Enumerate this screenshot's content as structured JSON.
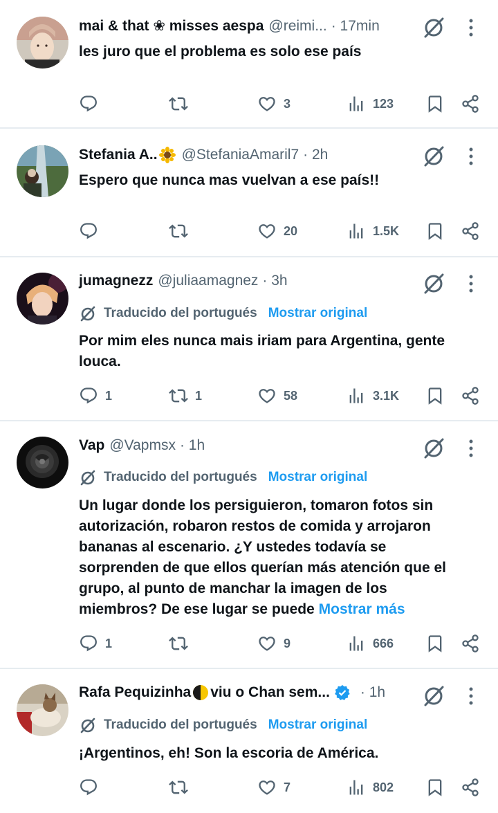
{
  "tweets": [
    {
      "name": "mai & that ❀ misses aespa",
      "handle": "@reimi...",
      "time": "· 17min",
      "text": "les juro que el problema es solo ese país",
      "reply_count": "",
      "retweet_count": "",
      "like_count": "3",
      "view_count": "123"
    },
    {
      "name": "Stefania A..",
      "handle": "@StefaniaAmaril7",
      "time": "· 2h",
      "text": "Espero que nunca mas vuelvan a ese país!!",
      "reply_count": "",
      "retweet_count": "",
      "like_count": "20",
      "view_count": "1.5K"
    },
    {
      "name": "jumagnezz",
      "handle": "@juliaamagnez",
      "time": "· 3h",
      "translated_label": "Traducido del portugués",
      "show_original": "Mostrar original",
      "text_lines": [
        "Por mim eles nunca mais iriam para Argentina, gente",
        "louca."
      ],
      "reply_count": "1",
      "retweet_count": "1",
      "like_count": "58",
      "view_count": "3.1K"
    },
    {
      "name": "Vap",
      "handle": "@Vapmsx",
      "time": "· 1h",
      "translated_label": "Traducido del portugués",
      "show_original": "Mostrar original",
      "text_lines": [
        "Un lugar donde los persiguieron, tomaron fotos sin",
        "autorización, robaron restos de comida y arrojaron",
        "bananas al escenario. ¿Y ustedes todavía se",
        "sorprenden de que ellos querían más atención que el",
        "grupo, al punto de manchar la imagen de los",
        "miembros? De ese lugar se puede"
      ],
      "show_more": "Mostrar más",
      "reply_count": "1",
      "retweet_count": "",
      "like_count": "9",
      "view_count": "666"
    },
    {
      "name_part1": "Rafa Pequizinha",
      "name_part2": "viu o Chan sem...",
      "time": "· 1h",
      "translated_label": "Traducido del portugués",
      "show_original": "Mostrar original",
      "text": "¡Argentinos, eh! Son la escoria de América.",
      "reply_count": "",
      "retweet_count": "",
      "like_count": "7",
      "view_count": "802"
    }
  ],
  "icons": {
    "reply": "reply-icon",
    "retweet": "retweet-icon",
    "like": "heart-icon",
    "views": "views-icon",
    "bookmark": "bookmark-icon",
    "share": "share-icon",
    "grok": "grok-icon",
    "more": "more-icon",
    "translate": "translate-icon"
  },
  "colors": {
    "link": "#1d9bf0",
    "secondary": "#536471",
    "text": "#0f1419",
    "verified": "#1d9bf0",
    "divider": "#e6ecf0"
  }
}
